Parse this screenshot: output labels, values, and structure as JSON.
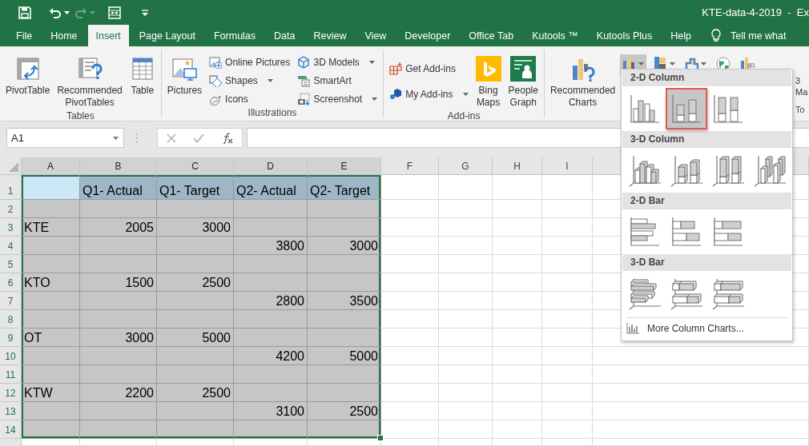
{
  "title_bar": {
    "title": "KTE-data-4-2019  -  Ex"
  },
  "tabs": [
    {
      "label": "File",
      "selected": false
    },
    {
      "label": "Home",
      "selected": false
    },
    {
      "label": "Insert",
      "selected": true
    },
    {
      "label": "Page Layout",
      "selected": false
    },
    {
      "label": "Formulas",
      "selected": false
    },
    {
      "label": "Data",
      "selected": false
    },
    {
      "label": "Review",
      "selected": false
    },
    {
      "label": "View",
      "selected": false
    },
    {
      "label": "Developer",
      "selected": false
    },
    {
      "label": "Office Tab",
      "selected": false
    },
    {
      "label": "Kutools ™",
      "selected": false
    },
    {
      "label": "Kutools Plus",
      "selected": false
    },
    {
      "label": "Help",
      "selected": false
    }
  ],
  "tell_me": "Tell me what",
  "ribbon": {
    "groups": [
      {
        "label": "Tables",
        "commands": [
          {
            "label": "PivotTable",
            "kind": "large"
          },
          {
            "label": "Recommended PivotTables",
            "kind": "large"
          },
          {
            "label": "Table",
            "kind": "large"
          }
        ]
      },
      {
        "label": "Illustrations",
        "commands": [
          {
            "label": "Pictures",
            "kind": "large"
          },
          {
            "label": "Online Pictures",
            "kind": "small",
            "has_menu": false
          },
          {
            "label": "Shapes",
            "kind": "small",
            "has_menu": true
          },
          {
            "label": "Icons",
            "kind": "small",
            "has_menu": false
          },
          {
            "label": "3D Models",
            "kind": "small",
            "has_menu": true
          },
          {
            "label": "SmartArt",
            "kind": "small",
            "has_menu": false
          },
          {
            "label": "Screenshot",
            "kind": "small",
            "has_menu": true
          }
        ]
      },
      {
        "label": "Add-ins",
        "commands": [
          {
            "label": "Get Add-ins",
            "kind": "small",
            "has_menu": false
          },
          {
            "label": "My Add-ins",
            "kind": "small",
            "has_menu": true
          },
          {
            "label": "Bing Maps",
            "kind": "large"
          },
          {
            "label": "People Graph",
            "kind": "large"
          }
        ]
      },
      {
        "commands": [
          {
            "label": "Recommended Charts",
            "kind": "large"
          }
        ],
        "chart_buttons": [
          {
            "pressed": true,
            "has_menu": true
          },
          {
            "pressed": false,
            "has_menu": true
          },
          {
            "pressed": false,
            "has_menu": true
          },
          {
            "pressed": false,
            "has_menu": false
          },
          {
            "pressed": false,
            "has_menu": false
          }
        ]
      },
      {
        "label": "To",
        "commands": [
          {
            "label": "3",
            "kind": "cut"
          },
          {
            "label": "Ma",
            "kind": "cut"
          }
        ]
      }
    ]
  },
  "formula_bar": {
    "name_box": "A1"
  },
  "sheet": {
    "columns": [
      {
        "label": "A",
        "selected": true
      },
      {
        "label": "B",
        "selected": true
      },
      {
        "label": "C",
        "selected": true
      },
      {
        "label": "D",
        "selected": true
      },
      {
        "label": "E",
        "selected": true
      },
      {
        "label": "F",
        "selected": false
      },
      {
        "label": "G",
        "selected": false
      },
      {
        "label": "H",
        "selected": false
      },
      {
        "label": "I",
        "selected": false
      }
    ],
    "rows": [
      {
        "label": "1",
        "selected": true,
        "kind": "header",
        "cells": [
          null,
          "Q1- Actual",
          "Q1- Target",
          "Q2- Actual",
          "Q2- Target"
        ]
      },
      {
        "label": "2",
        "selected": true,
        "kind": "data"
      },
      {
        "label": "3",
        "selected": true,
        "kind": "data",
        "cells": [
          "KTE",
          "2005",
          "3000"
        ]
      },
      {
        "label": "4",
        "selected": true,
        "kind": "data",
        "cells": [
          null,
          null,
          null,
          "3800",
          "3000"
        ]
      },
      {
        "label": "5",
        "selected": true,
        "kind": "data"
      },
      {
        "label": "6",
        "selected": true,
        "kind": "data",
        "cells": [
          "KTO",
          "1500",
          "2500"
        ]
      },
      {
        "label": "7",
        "selected": true,
        "kind": "data",
        "cells": [
          null,
          null,
          null,
          "2800",
          "3500"
        ]
      },
      {
        "label": "8",
        "selected": true,
        "kind": "data"
      },
      {
        "label": "9",
        "selected": true,
        "kind": "data",
        "cells": [
          "OT",
          "3000",
          "5000"
        ]
      },
      {
        "label": "10",
        "selected": true,
        "kind": "data",
        "cells": [
          null,
          null,
          null,
          "4200",
          "5000"
        ]
      },
      {
        "label": "11",
        "selected": true,
        "kind": "data"
      },
      {
        "label": "12",
        "selected": true,
        "kind": "data",
        "cells": [
          "KTW",
          "2200",
          "2500"
        ]
      },
      {
        "label": "13",
        "selected": true,
        "kind": "data",
        "cells": [
          null,
          null,
          null,
          "3100",
          "2500"
        ]
      },
      {
        "label": "14",
        "selected": true,
        "kind": "data"
      }
    ]
  },
  "chart_menu": {
    "sections": [
      {
        "title": "2-D Column",
        "options": [
          {
            "selected": false
          },
          {
            "selected": true
          },
          {
            "selected": false
          }
        ]
      },
      {
        "title": "3-D Column",
        "options": [
          {
            "selected": false
          },
          {
            "selected": false
          },
          {
            "selected": false
          },
          {
            "selected": false
          }
        ]
      },
      {
        "title": "2-D Bar",
        "options": [
          {
            "selected": false
          },
          {
            "selected": false
          },
          {
            "selected": false
          }
        ]
      },
      {
        "title": "3-D Bar",
        "options": [
          {
            "selected": false
          },
          {
            "selected": false
          },
          {
            "selected": false
          }
        ]
      }
    ],
    "more_link": "More Column Charts..."
  }
}
